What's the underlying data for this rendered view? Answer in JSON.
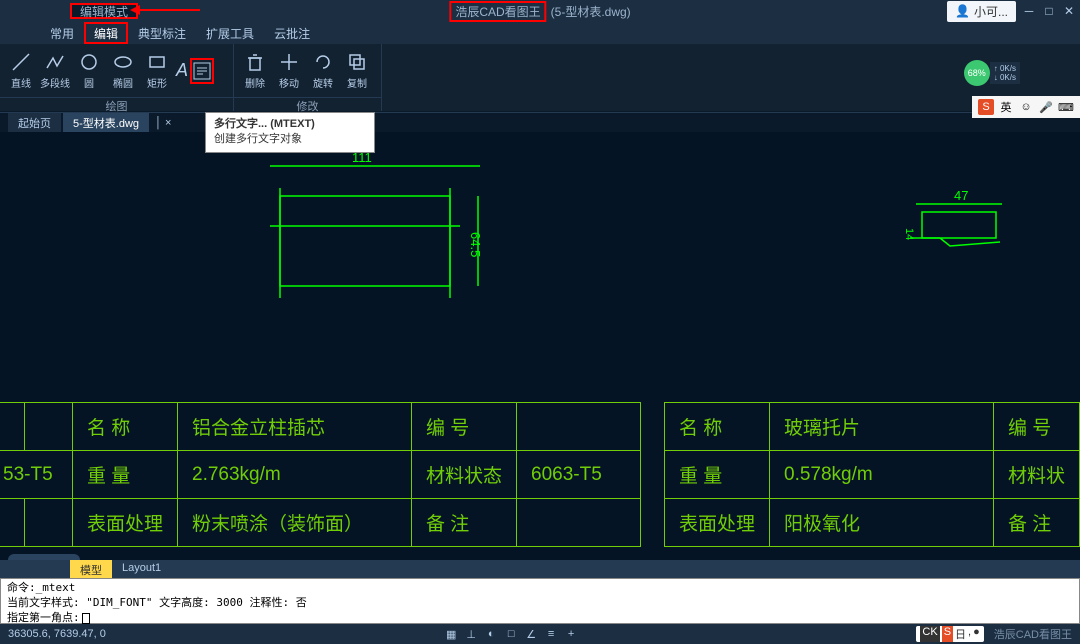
{
  "titlebar": {
    "mode_label": "编辑模式",
    "app_name": "浩辰CAD看图王",
    "file_name": "(5-型材表.dwg)",
    "user_name": "小可..."
  },
  "window_controls": {
    "min": "─",
    "restore": "□",
    "close": "✕"
  },
  "performance": {
    "percent": "68%",
    "line1": "0K/s",
    "line2": "0K/s"
  },
  "menutabs": [
    "常用",
    "编辑",
    "典型标注",
    "扩展工具",
    "云批注"
  ],
  "ribbon": {
    "draw": {
      "label": "绘图",
      "tools": [
        {
          "id": "line",
          "label": "直线"
        },
        {
          "id": "polyline",
          "label": "多段线"
        },
        {
          "id": "circle",
          "label": "圆"
        },
        {
          "id": "ellipse",
          "label": "椭圆"
        },
        {
          "id": "rectangle",
          "label": "矩形"
        },
        {
          "id": "text",
          "label": ""
        },
        {
          "id": "mtext",
          "label": ""
        }
      ]
    },
    "modify": {
      "label": "修改",
      "tools": [
        {
          "id": "delete",
          "label": "删除"
        },
        {
          "id": "move",
          "label": "移动"
        },
        {
          "id": "rotate",
          "label": "旋转"
        },
        {
          "id": "copy",
          "label": "复制"
        }
      ]
    }
  },
  "ime": {
    "lang": "英"
  },
  "doctabs": {
    "start": "起始页",
    "file": "5-型材表.dwg"
  },
  "tooltip": {
    "title": "多行文字... (MTEXT)",
    "desc": "创建多行文字对象"
  },
  "drawing": {
    "dim_top_left": "111",
    "dim_side_left": "64.5",
    "dim_top_right": "47",
    "dim_side_right": "14"
  },
  "table_data": {
    "left": {
      "name_label": "名  称",
      "name_val": "铝合金立柱插芯",
      "num_label": "编  号",
      "weight_label": "重  量",
      "weight_val": "2.763kg/m",
      "mat_label": "材料状态",
      "mat_val": "6063-T5",
      "surf_label": "表面处理",
      "surf_val": "粉末喷涂（装饰面）",
      "note_label": "备  注",
      "mat_prefix": "53-T5"
    },
    "right": {
      "name_label": "名  称",
      "name_val": "玻璃托片",
      "num_label": "编  号",
      "weight_label": "重  量",
      "weight_val": "0.578kg/m",
      "mat_label": "材料状",
      "surf_label": "表面处理",
      "surf_val": "阳极氧化",
      "note_label": "备  注"
    }
  },
  "layout_tabs": {
    "model": "模型",
    "layout1": "Layout1"
  },
  "command": {
    "line1": "命令:_mtext",
    "line2": "当前文字样式: \"DIM_FONT\"  文字高度:  3000  注释性:  否",
    "prompt": "指定第一角点:"
  },
  "status": {
    "coords": "36305.6, 7639.47, 0",
    "watermark": "浩辰CAD看图王"
  }
}
